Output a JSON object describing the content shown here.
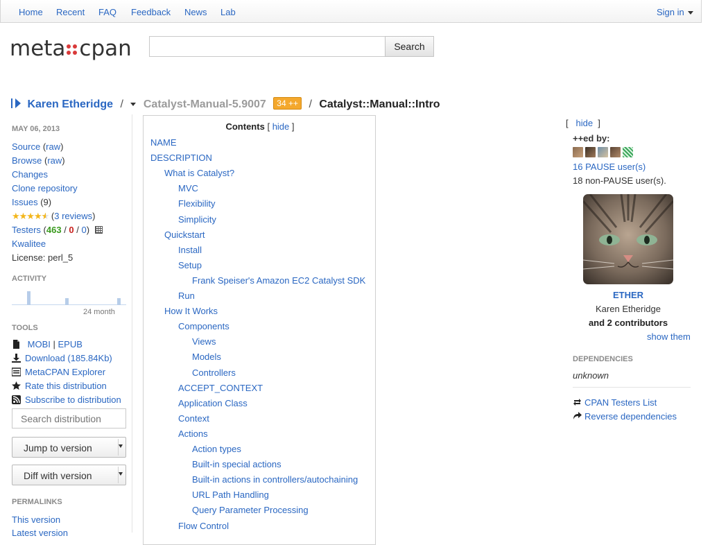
{
  "nav": {
    "items": [
      "Home",
      "Recent",
      "FAQ",
      "Feedback",
      "News",
      "Lab"
    ],
    "sign_in": "Sign in"
  },
  "logo": {
    "left": "meta",
    "right": "cpan"
  },
  "search": {
    "value": "",
    "button": "Search"
  },
  "breadcrumb": {
    "author": "Karen Etheridge",
    "sep1": "/",
    "distribution": "Catalyst-Manual-5.9007",
    "plusplus": "34 ++",
    "sep2": "/",
    "module": "Catalyst::Manual::Intro"
  },
  "sidebar": {
    "date": "MAY 06, 2013",
    "source": "Source",
    "source_raw": "raw",
    "browse": "Browse",
    "browse_raw": "raw",
    "changes": "Changes",
    "clone": "Clone repository",
    "issues": "Issues",
    "issues_count": "(9)",
    "reviews": "3 reviews",
    "rating": 4.5,
    "testers": "Testers",
    "testers_pass": "463",
    "testers_fail": "0",
    "testers_na": "0",
    "kwalitee": "Kwalitee",
    "license": "License: perl_5",
    "activity_heading": "ACTIVITY",
    "activity_label": "24 month",
    "activity_values": [
      0,
      0,
      0,
      1,
      0,
      0,
      0,
      0,
      0,
      0,
      0,
      0.5,
      0,
      0,
      0,
      0,
      0,
      0,
      0,
      0,
      0,
      0,
      0.5,
      0
    ],
    "tools_heading": "TOOLS",
    "mobi": "MOBI",
    "epub": "EPUB",
    "download": "Download (185.84Kb)",
    "explorer": "MetaCPAN Explorer",
    "rate": "Rate this distribution",
    "subscribe": "Subscribe to distribution",
    "search_placeholder": "Search distribution",
    "jump": "Jump to version",
    "diff": "Diff with version",
    "permalinks_heading": "PERMALINKS",
    "this_version": "This version",
    "latest_version": "Latest version"
  },
  "toc": {
    "title": "Contents",
    "hide": "hide",
    "items": [
      {
        "label": "NAME",
        "level": 0
      },
      {
        "label": "DESCRIPTION",
        "level": 0
      },
      {
        "label": "What is Catalyst?",
        "level": 1
      },
      {
        "label": "MVC",
        "level": 2
      },
      {
        "label": "Flexibility",
        "level": 2
      },
      {
        "label": "Simplicity",
        "level": 2
      },
      {
        "label": "Quickstart",
        "level": 1
      },
      {
        "label": "Install",
        "level": 2
      },
      {
        "label": "Setup",
        "level": 2
      },
      {
        "label": "Frank Speiser's Amazon EC2 Catalyst SDK",
        "level": 3
      },
      {
        "label": "Run",
        "level": 2
      },
      {
        "label": "How It Works",
        "level": 1
      },
      {
        "label": "Components",
        "level": 2
      },
      {
        "label": "Views",
        "level": 3
      },
      {
        "label": "Models",
        "level": 3
      },
      {
        "label": "Controllers",
        "level": 3
      },
      {
        "label": "ACCEPT_CONTEXT",
        "level": 2
      },
      {
        "label": "Application Class",
        "level": 2
      },
      {
        "label": "Context",
        "level": 2
      },
      {
        "label": "Actions",
        "level": 2
      },
      {
        "label": "Action types",
        "level": 3
      },
      {
        "label": "Built-in special actions",
        "level": 3
      },
      {
        "label": "Built-in actions in controllers/autochaining",
        "level": 3
      },
      {
        "label": "URL Path Handling",
        "level": 3
      },
      {
        "label": "Query Parameter Processing",
        "level": 3
      },
      {
        "label": "Flow Control",
        "level": 2
      }
    ]
  },
  "right": {
    "hide": "hide",
    "plusplus_by": "++ed by:",
    "pause_users": "16 PAUSE user(s)",
    "non_pause_users": "18 non-PAUSE user(s).",
    "author_id": "ETHER",
    "author_name": "Karen Etheridge",
    "contributors": "and 2 contributors",
    "show_them": "show them",
    "deps_heading": "DEPENDENCIES",
    "deps_value": "unknown",
    "testers_list": "CPAN Testers List",
    "reverse_deps": "Reverse dependencies"
  },
  "colors": {
    "link": "#2a67c2",
    "logo_dots": "#d93a3a",
    "badge": "#f4a82d",
    "pass": "#3a9a1e",
    "fail": "#c8211e"
  }
}
